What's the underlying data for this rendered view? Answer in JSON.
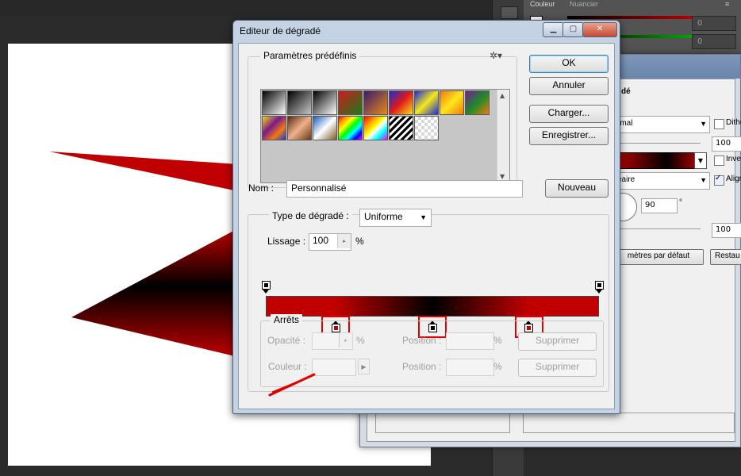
{
  "colors": {
    "accent": "#c00000",
    "gradient_start": "#c00000",
    "gradient_mid": "#000000",
    "gradient_end": "#c00000",
    "highlight": "#e00000"
  },
  "photoshop_panel": {
    "tab_color": "Couleur",
    "tab_swatches": "Nuancier",
    "channel_values": [
      "0",
      "0"
    ]
  },
  "layer_style_dialog": {
    "title_fragment": "dé",
    "blend_mode": "rmal",
    "dither_label": "Dithe",
    "opacity_value": "100",
    "reverse_label": "Inve",
    "style_value": "éaire",
    "align_label": "Align",
    "angle_value": "90",
    "angle_unit": "°",
    "scale_value": "100",
    "defaults_button": "mètres par défaut",
    "reset_button": "Restau"
  },
  "gradient_editor": {
    "title": "Editeur de dégradé",
    "window_controls": {
      "minimize": "▁",
      "maximize": "▢",
      "close": "✕"
    },
    "presets": {
      "legend": "Paramètres prédéfinis",
      "settings_icon": "gear-icon",
      "swatches": [
        {
          "name": "foreground-to-background",
          "css": "linear-gradient(135deg,#000 0%,#fff 100%)"
        },
        {
          "name": "foreground-to-transparent",
          "css": "linear-gradient(135deg,#000 0%,rgba(0,0,0,0) 100%)"
        },
        {
          "name": "black-white",
          "css": "linear-gradient(135deg,#000 0%,#fff 100%)"
        },
        {
          "name": "red-green",
          "css": "linear-gradient(135deg,#d11a1a 0%,#1a7a1a 100%)"
        },
        {
          "name": "violet-orange",
          "css": "linear-gradient(135deg,#3a1a6a 0%,#e88a1a 100%)"
        },
        {
          "name": "blue-red-yellow",
          "css": "linear-gradient(135deg,#1a2ad8 0%,#e01a1a 50%,#f5e01a 100%)"
        },
        {
          "name": "blue-yellow-blue",
          "css": "linear-gradient(135deg,#1a2ad8 0%,#f5e81a 50%,#1a2ad8 100%)"
        },
        {
          "name": "orange-yellow-orange",
          "css": "linear-gradient(135deg,#f07a10 0%,#ffe61a 50%,#f07a10 100%)"
        },
        {
          "name": "violet-green-orange",
          "css": "linear-gradient(135deg,#7a1a9a 0%,#1a8a2a 50%,#f07a10 100%)"
        },
        {
          "name": "yellow-violet-orange-blue",
          "css": "linear-gradient(135deg,#f5d81a 0%,#7a1a8a 40%,#f07a10 70%,#1a3ad8 100%)"
        },
        {
          "name": "copper",
          "css": "linear-gradient(135deg,#5a2a10 0%,#f0b08a 50%,#6a3a1a 100%)"
        },
        {
          "name": "chrome",
          "css": "linear-gradient(135deg,#1a5ab8 0%,#ffffff 50%,#7a5a2a 100%)"
        },
        {
          "name": "spectrum",
          "css": "linear-gradient(135deg,#ff0000,#ff9900,#ffff00,#00ff00,#00ffff,#0000ff,#ff00ff)"
        },
        {
          "name": "transparent-rainbow",
          "css": "linear-gradient(135deg,#ff0000 0%,#ff9900 25%,#ffff00 45%,#ffffff 55%,#00ffff 75%,#ff00ff 100%)"
        },
        {
          "name": "transparent-stripes",
          "css": "repeating-linear-gradient(135deg,#000 0px,#000 3px,#fff 3px,#fff 6px)"
        },
        {
          "name": "neutral-density",
          "css": "repeating-conic-gradient(#d8d8d8 0% 25%,#fff 0% 50%)"
        }
      ]
    },
    "buttons": {
      "ok": "OK",
      "cancel": "Annuler",
      "load": "Charger...",
      "save": "Enregistrer...",
      "new": "Nouveau"
    },
    "name": {
      "label": "Nom :",
      "value": "Personnalisé"
    },
    "gradient_type": {
      "label": "Type de dégradé :",
      "value": "Uniforme"
    },
    "smoothness": {
      "label": "Lissage :",
      "value": "100",
      "unit": "%"
    },
    "stops": {
      "legend": "Arrêts",
      "opacity_label": "Opacité :",
      "opacity_unit": "%",
      "color_label": "Couleur :",
      "position_label": "Position :",
      "position_unit": "%",
      "delete_label": "Supprimer",
      "opacity_stops": [
        {
          "position": 0
        },
        {
          "position": 100
        }
      ],
      "color_stops": [
        {
          "position": 21,
          "color": "#c00000"
        },
        {
          "position": 50,
          "color": "#000000"
        },
        {
          "position": 79,
          "color": "#c00000"
        }
      ]
    }
  }
}
